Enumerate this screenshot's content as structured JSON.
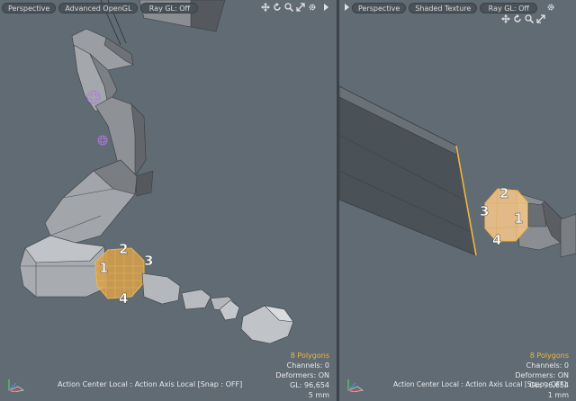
{
  "left_viewport": {
    "toolbar": {
      "view": "Perspective",
      "shading": "Advanced OpenGL",
      "raygl": "Ray GL: Off"
    },
    "labels": [
      "1",
      "2",
      "3",
      "4"
    ],
    "stats": {
      "polygons": "8 Polygons",
      "channels": "Channels: 0",
      "deformers": "Deformers: ON",
      "gl": "GL: 96,654",
      "scale": "5 mm"
    },
    "action_center": "Action Center Local : Action Axis Local  [Snap : OFF]"
  },
  "right_viewport": {
    "toolbar": {
      "view": "Perspective",
      "shading": "Shaded Texture",
      "raygl": "Ray GL: Off"
    },
    "labels": [
      "1",
      "2",
      "3",
      "4"
    ],
    "stats": {
      "polygons": "8 Polygons",
      "channels": "Channels: 0",
      "deformers": "Deformers: ON",
      "gl": "GL: 96,654",
      "scale": "1 mm"
    },
    "action_center": "Action Center Local : Action Axis Local  [Snap : OFF]"
  },
  "icons": [
    "move-icon",
    "rotate-icon",
    "zoom-icon",
    "maximize-icon",
    "gear-icon"
  ],
  "colors": {
    "viewport_bg": "#606b74",
    "selection": "#f0b542",
    "mesh": "#8c9094"
  }
}
